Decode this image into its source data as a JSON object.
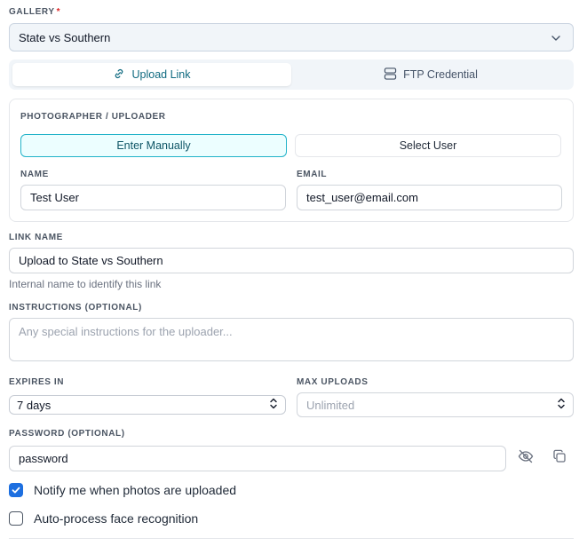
{
  "gallery": {
    "label": "GALLERY",
    "required_mark": "*",
    "value": "State vs Southern"
  },
  "tabs": [
    {
      "label": "Upload Link",
      "icon": "link-icon",
      "active": true
    },
    {
      "label": "FTP Credential",
      "icon": "server-icon",
      "active": false
    }
  ],
  "photographer": {
    "heading": "PHOTOGRAPHER / UPLOADER",
    "modes": [
      {
        "label": "Enter Manually",
        "selected": true
      },
      {
        "label": "Select User",
        "selected": false
      }
    ],
    "name": {
      "label": "NAME",
      "value": "Test User"
    },
    "email": {
      "label": "EMAIL",
      "value": "test_user@email.com"
    }
  },
  "link_name": {
    "label": "LINK NAME",
    "value": "Upload to State vs Southern",
    "hint": "Internal name to identify this link"
  },
  "instructions": {
    "label": "INSTRUCTIONS (OPTIONAL)",
    "placeholder": "Any special instructions for the uploader..."
  },
  "expires": {
    "label": "EXPIRES IN",
    "value": "7 days"
  },
  "max_uploads": {
    "label": "MAX UPLOADS",
    "placeholder": "Unlimited"
  },
  "password": {
    "label": "PASSWORD (OPTIONAL)",
    "value": "password"
  },
  "options": [
    {
      "label": "Notify me when photos are uploaded",
      "checked": true
    },
    {
      "label": "Auto-process face recognition",
      "checked": false
    }
  ],
  "colors": {
    "accent": "#22b3c9",
    "checkbox": "#1d6fe0",
    "required": "#dc2626"
  }
}
